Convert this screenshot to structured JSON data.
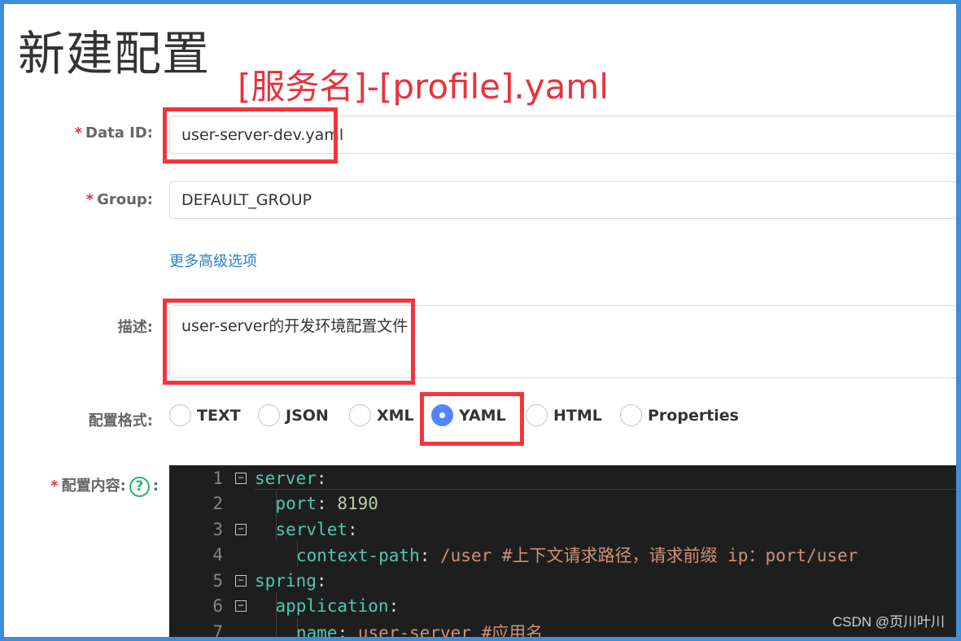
{
  "page": {
    "title": "新建配置",
    "annotation": "[服务名]-[profile].yaml"
  },
  "form": {
    "data_id": {
      "required": "*",
      "label": "Data ID:",
      "value": "user-server-dev.yaml"
    },
    "group": {
      "required": "*",
      "label": "Group:",
      "value": "DEFAULT_GROUP"
    },
    "advanced_link": "更多高级选项",
    "description": {
      "label": "描述:",
      "value": "user-server的开发环境配置文件"
    },
    "format": {
      "label": "配置格式:",
      "options": [
        "TEXT",
        "JSON",
        "XML",
        "YAML",
        "HTML",
        "Properties"
      ],
      "selected": "YAML"
    },
    "content": {
      "required": "*",
      "label": "配置内容:",
      "help_icon": "question-circle-icon",
      "suffix": ":"
    }
  },
  "editor": {
    "lines": [
      {
        "num": "1",
        "fold": "⊟",
        "key": "server",
        "sep": ":",
        "val": "",
        "comment": ""
      },
      {
        "num": "2",
        "fold": "",
        "key": "port",
        "sep": ": ",
        "val": "8190",
        "comment": ""
      },
      {
        "num": "3",
        "fold": "⊟",
        "key": "servlet",
        "sep": ":",
        "val": "",
        "comment": ""
      },
      {
        "num": "4",
        "fold": "",
        "key": "context-path",
        "sep": ": ",
        "val": "/user",
        "comment": " #上下文请求路径，请求前缀 ip：port/user"
      },
      {
        "num": "5",
        "fold": "⊟",
        "key": "spring",
        "sep": ":",
        "val": "",
        "comment": ""
      },
      {
        "num": "6",
        "fold": "⊟",
        "key": "application",
        "sep": ":",
        "val": "",
        "comment": ""
      },
      {
        "num": "7",
        "fold": "",
        "key": "name",
        "sep": ": ",
        "val": "user-server",
        "comment": " #应用名"
      }
    ]
  },
  "watermark": "CSDN @页川叶川",
  "colors": {
    "highlight_box": "#f3343c",
    "annotation": "#e8323c",
    "link": "#2a7fd1",
    "radio_checked": "#5584ff",
    "editor_bg": "#1e1e1e"
  }
}
